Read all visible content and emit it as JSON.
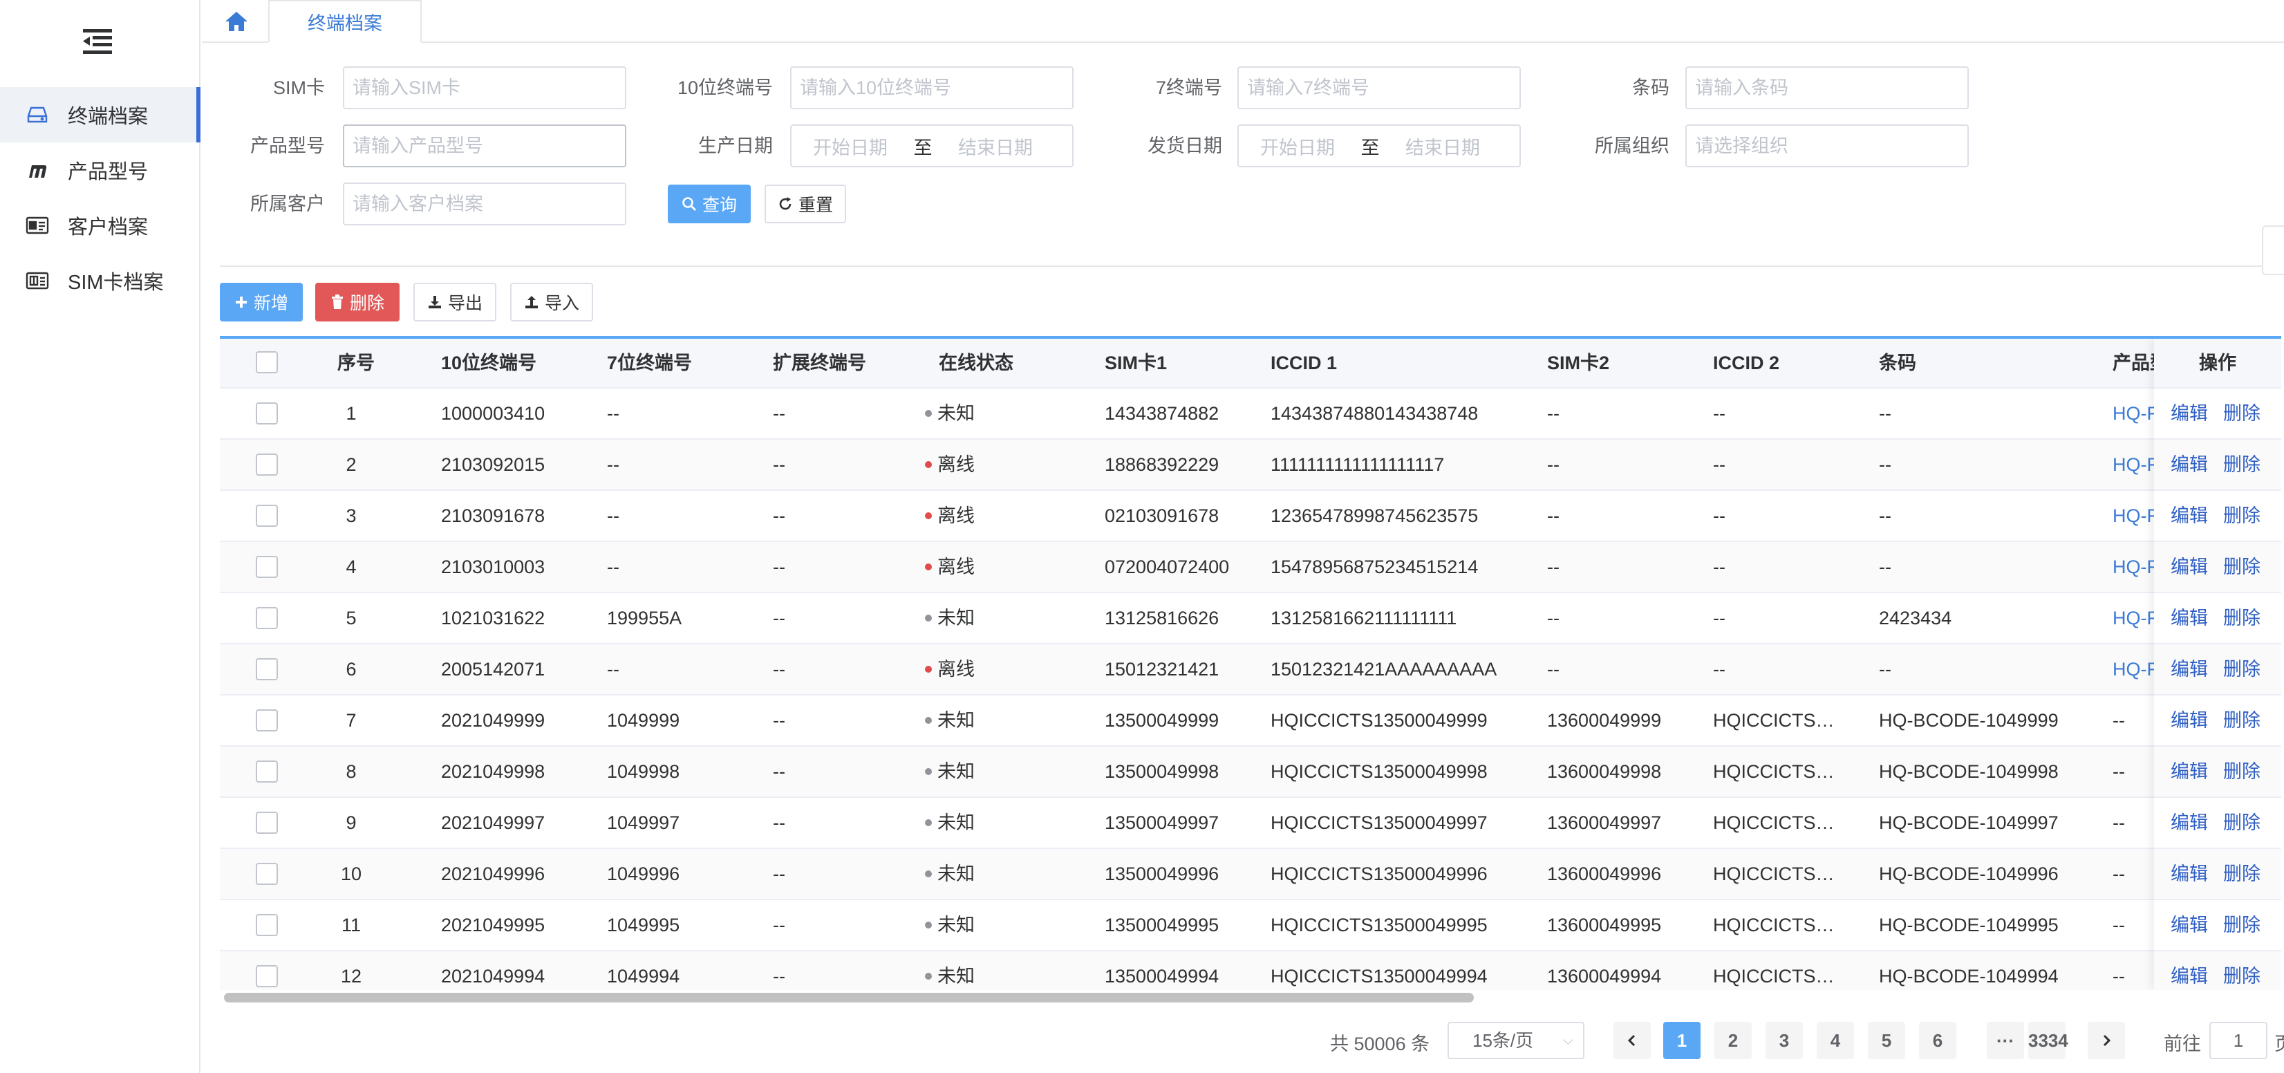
{
  "sidebar": {
    "items": [
      {
        "label": "终端档案",
        "icon": "drive-icon",
        "active": true
      },
      {
        "label": "产品型号",
        "icon": "m-logo-icon",
        "active": false
      },
      {
        "label": "客户档案",
        "icon": "id-card-icon",
        "active": false
      },
      {
        "label": "SIM卡档案",
        "icon": "sim-card-icon",
        "active": false
      }
    ]
  },
  "tabs": {
    "active_label": "终端档案"
  },
  "form": {
    "sim_label": "SIM卡",
    "sim_placeholder": "请输入SIM卡",
    "term10_label": "10位终端号",
    "term10_placeholder": "请输入10位终端号",
    "term7_label": "7终端号",
    "term7_placeholder": "请输入7终端号",
    "barcode_label": "条码",
    "barcode_placeholder": "请输入条码",
    "model_label": "产品型号",
    "model_placeholder": "请输入产品型号",
    "prod_date_label": "生产日期",
    "ship_date_label": "发货日期",
    "date_start": "开始日期",
    "date_sep": "至",
    "date_end": "结束日期",
    "org_label": "所属组织",
    "org_placeholder": "请选择组织",
    "customer_label": "所属客户",
    "customer_placeholder": "请输入客户档案",
    "query_label": "查询",
    "reset_label": "重置"
  },
  "toolbar": {
    "add_label": "新增",
    "delete_label": "删除",
    "export_label": "导出",
    "import_label": "导入"
  },
  "table": {
    "headers": {
      "index": "序号",
      "term10": "10位终端号",
      "term7": "7位终端号",
      "ext": "扩展终端号",
      "status": "在线状态",
      "sim1": "SIM卡1",
      "iccid1": "ICCID 1",
      "sim2": "SIM卡2",
      "iccid2": "ICCID 2",
      "barcode": "条码",
      "model": "产品型",
      "ops": "操作"
    },
    "edit_label": "编辑",
    "delete_label": "删除",
    "status_colors": {
      "未知": "#909399",
      "离线": "#e04b4b"
    },
    "rows": [
      {
        "index": "1",
        "term10": "1000003410",
        "term7": "--",
        "ext": "--",
        "status": "未知",
        "sim1": "14343874882",
        "iccid1": "14343874880143438748",
        "sim2": "--",
        "iccid2": "--",
        "barcode": "--",
        "model": "HQ-F"
      },
      {
        "index": "2",
        "term10": "2103092015",
        "term7": "--",
        "ext": "--",
        "status": "离线",
        "sim1": "18868392229",
        "iccid1": "1111111111111111117",
        "sim2": "--",
        "iccid2": "--",
        "barcode": "--",
        "model": "HQ-F"
      },
      {
        "index": "3",
        "term10": "2103091678",
        "term7": "--",
        "ext": "--",
        "status": "离线",
        "sim1": "02103091678",
        "iccid1": "12365478998745623575",
        "sim2": "--",
        "iccid2": "--",
        "barcode": "--",
        "model": "HQ-F"
      },
      {
        "index": "4",
        "term10": "2103010003",
        "term7": "--",
        "ext": "--",
        "status": "离线",
        "sim1": "072004072400",
        "iccid1": "15478956875234515214",
        "sim2": "--",
        "iccid2": "--",
        "barcode": "--",
        "model": "HQ-F"
      },
      {
        "index": "5",
        "term10": "1021031622",
        "term7": "199955A",
        "ext": "--",
        "status": "未知",
        "sim1": "13125816626",
        "iccid1": "1312581662111111111",
        "sim2": "--",
        "iccid2": "--",
        "barcode": "2423434",
        "model": "HQ-F"
      },
      {
        "index": "6",
        "term10": "2005142071",
        "term7": "--",
        "ext": "--",
        "status": "离线",
        "sim1": "15012321421",
        "iccid1": "15012321421AAAAAAAAA",
        "sim2": "--",
        "iccid2": "--",
        "barcode": "--",
        "model": "HQ-F"
      },
      {
        "index": "7",
        "term10": "2021049999",
        "term7": "1049999",
        "ext": "--",
        "status": "未知",
        "sim1": "13500049999",
        "iccid1": "HQICCICTS13500049999",
        "sim2": "13600049999",
        "iccid2": "HQICCICTS…",
        "barcode": "HQ-BCODE-1049999",
        "model": "--"
      },
      {
        "index": "8",
        "term10": "2021049998",
        "term7": "1049998",
        "ext": "--",
        "status": "未知",
        "sim1": "13500049998",
        "iccid1": "HQICCICTS13500049998",
        "sim2": "13600049998",
        "iccid2": "HQICCICTS…",
        "barcode": "HQ-BCODE-1049998",
        "model": "--"
      },
      {
        "index": "9",
        "term10": "2021049997",
        "term7": "1049997",
        "ext": "--",
        "status": "未知",
        "sim1": "13500049997",
        "iccid1": "HQICCICTS13500049997",
        "sim2": "13600049997",
        "iccid2": "HQICCICTS…",
        "barcode": "HQ-BCODE-1049997",
        "model": "--"
      },
      {
        "index": "10",
        "term10": "2021049996",
        "term7": "1049996",
        "ext": "--",
        "status": "未知",
        "sim1": "13500049996",
        "iccid1": "HQICCICTS13500049996",
        "sim2": "13600049996",
        "iccid2": "HQICCICTS…",
        "barcode": "HQ-BCODE-1049996",
        "model": "--"
      },
      {
        "index": "11",
        "term10": "2021049995",
        "term7": "1049995",
        "ext": "--",
        "status": "未知",
        "sim1": "13500049995",
        "iccid1": "HQICCICTS13500049995",
        "sim2": "13600049995",
        "iccid2": "HQICCICTS…",
        "barcode": "HQ-BCODE-1049995",
        "model": "--"
      },
      {
        "index": "12",
        "term10": "2021049994",
        "term7": "1049994",
        "ext": "--",
        "status": "未知",
        "sim1": "13500049994",
        "iccid1": "HQICCICTS13500049994",
        "sim2": "13600049994",
        "iccid2": "HQICCICTS…",
        "barcode": "HQ-BCODE-1049994",
        "model": "--"
      }
    ]
  },
  "pagination": {
    "total": "共 50006 条",
    "page_size": "15条/页",
    "pages": [
      "1",
      "2",
      "3",
      "4",
      "5",
      "6"
    ],
    "ellipsis": "···",
    "last_page": "3334",
    "current": "1",
    "goto_label": "前往",
    "goto_value": "1",
    "goto_suffix": "页"
  },
  "colors": {
    "primary": "#5aa7f5",
    "danger": "#e25858",
    "link": "#3a7bd5",
    "active_border": "#3a6fd8"
  }
}
